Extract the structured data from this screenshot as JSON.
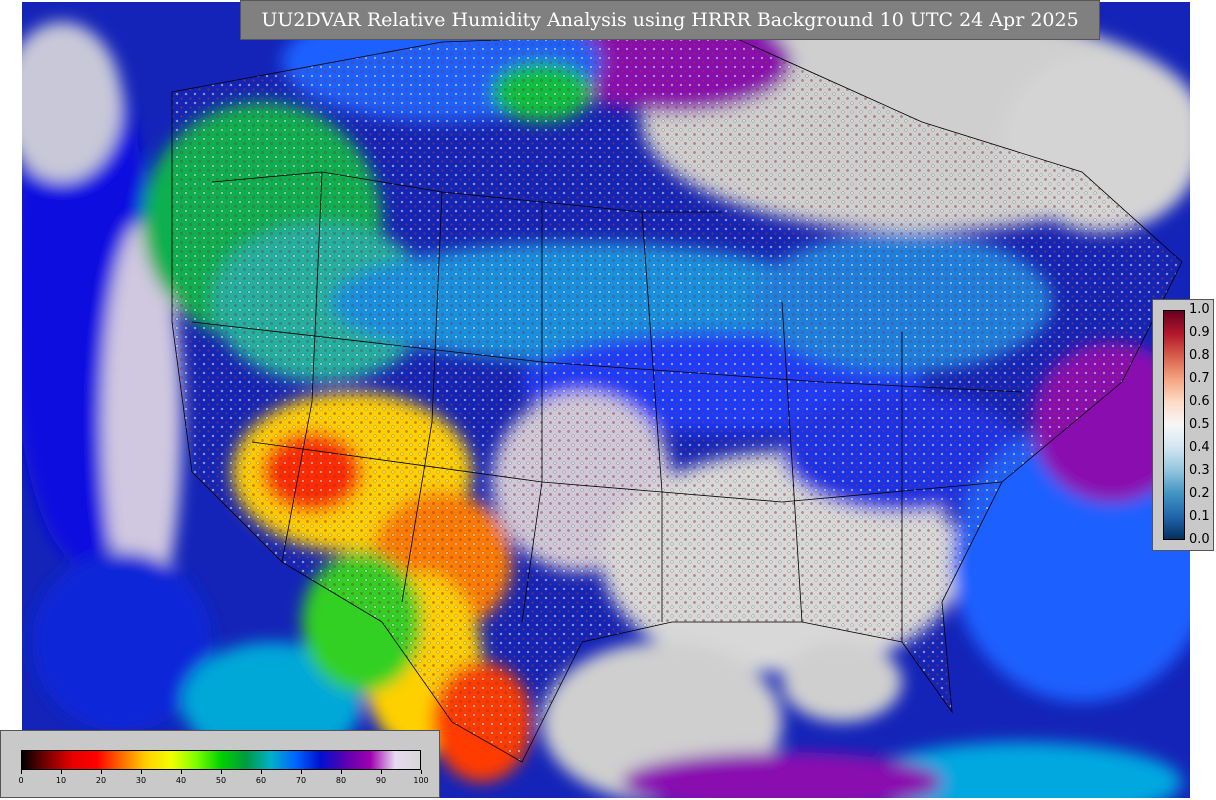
{
  "title": "UU2DVAR Relative Humidity Analysis using HRRR Background 10 UTC 24 Apr 2025",
  "rh_colorbar": {
    "ticks": [
      "0",
      "10",
      "20",
      "30",
      "40",
      "50",
      "60",
      "70",
      "80",
      "90",
      "100"
    ],
    "stops": [
      "#000000",
      "#7a0000",
      "#e60000",
      "#ff0000",
      "#ff6a00",
      "#ffd000",
      "#f2ff00",
      "#7dff00",
      "#00d200",
      "#009a40",
      "#00b0c8",
      "#0064ff",
      "#0010d0",
      "#5a00b0",
      "#a000b0",
      "#e8d8f0",
      "#d8d8d8"
    ]
  },
  "point_colorbar": {
    "ticks": [
      "1.0",
      "0.9",
      "0.8",
      "0.7",
      "0.6",
      "0.5",
      "0.4",
      "0.3",
      "0.2",
      "0.1",
      "0.0"
    ],
    "stops": [
      "#67001f",
      "#b2182b",
      "#d6604d",
      "#f4a582",
      "#fddbc7",
      "#f7f7f7",
      "#d1e5f0",
      "#92c5de",
      "#4393c3",
      "#2166ac",
      "#053061"
    ]
  },
  "map_colors": {
    "land_dry": "#ff2a00",
    "moist": "#1a1aff",
    "saturated": "#cfcfcf",
    "ocean": "#0a1aa8"
  }
}
